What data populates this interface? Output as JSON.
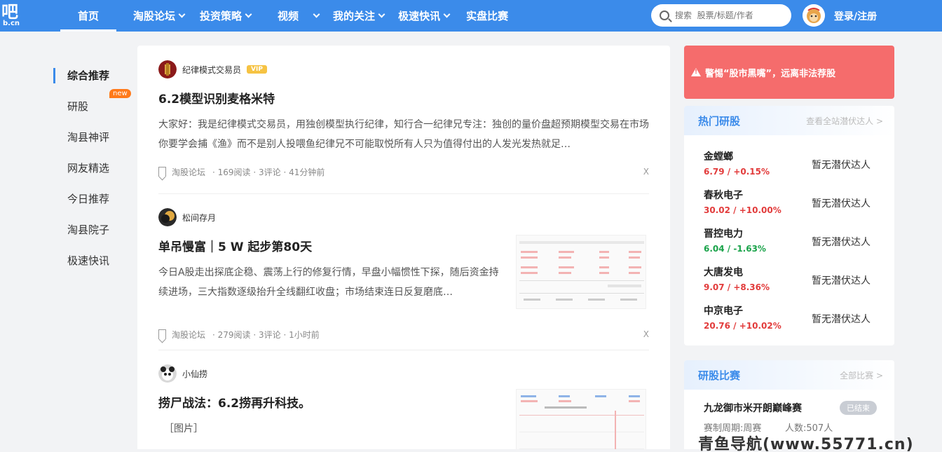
{
  "logo": {
    "main": "吧",
    "sub": "b.cn"
  },
  "nav": {
    "items": [
      {
        "label": "首页",
        "active": true,
        "dropdown": false
      },
      {
        "label": "淘股论坛",
        "active": false,
        "dropdown": true
      },
      {
        "label": "投资策略",
        "active": false,
        "dropdown": true
      },
      {
        "label": "视频",
        "active": false,
        "dropdown": true
      },
      {
        "label": "我的关注",
        "active": false,
        "dropdown": true
      },
      {
        "label": "极速快讯",
        "active": false,
        "dropdown": true
      },
      {
        "label": "实盘比赛",
        "active": false,
        "dropdown": false
      }
    ],
    "search_placeholder": "搜索  股票/标题/作者",
    "login": "登录/注册"
  },
  "left_menu": {
    "items": [
      {
        "label": "综合推荐",
        "active": true
      },
      {
        "label": "研股",
        "badge": "new"
      },
      {
        "label": "淘县神评"
      },
      {
        "label": "网友精选"
      },
      {
        "label": "今日推荐"
      },
      {
        "label": "淘县院子"
      },
      {
        "label": "极速快讯"
      }
    ]
  },
  "posts": [
    {
      "author": "纪律模式交易员",
      "vip": "VIP",
      "title": "6.2模型识别麦格米特",
      "text": "大家好：我是纪律模式交易员，用独创模型执行纪律，知行合一纪律兄专注：独创的量价盘超预期模型交易在市场你要学会捕《渔》而不是别人投喂鱼纪律兄不可能取悦所有人只为值得付出的人发光发热就足…",
      "forum": "淘股论坛",
      "stats": "· 169阅读 · 3评论 · 41分钟前",
      "close": "X"
    },
    {
      "author": "松间存月",
      "title": "单吊慢富｜5 W 起步第80天",
      "text": "今日A股走出探底企稳、震荡上行的修复行情，早盘小幅惯性下探，随后资金持续进场，三大指数逐级抬升全线翻红收盘；市场结束连日反复磨底…",
      "forum": "淘股论坛",
      "stats": "· 279阅读 · 3评论 · 1小时前",
      "close": "X"
    },
    {
      "author": "小仙捞",
      "title": "捞尸战法：6.2捞再升科技。",
      "text": "［图片］"
    }
  ],
  "warning": "警惕“股市黑嘴”，远离非法荐股",
  "hot_stocks": {
    "title": "热门研股",
    "more": "查看全站潜伏达人 >",
    "rows": [
      {
        "name": "金螳螂",
        "value": "6.79 / +0.15%",
        "trend": "up",
        "hint": "暂无潜伏达人"
      },
      {
        "name": "春秋电子",
        "value": "30.02 / +10.00%",
        "trend": "up",
        "hint": "暂无潜伏达人"
      },
      {
        "name": "晋控电力",
        "value": "6.04 / -1.63%",
        "trend": "down",
        "hint": "暂无潜伏达人"
      },
      {
        "name": "大唐发电",
        "value": "9.07 / +8.36%",
        "trend": "up",
        "hint": "暂无潜伏达人"
      },
      {
        "name": "中京电子",
        "value": "20.76 / +10.02%",
        "trend": "up",
        "hint": "暂无潜伏达人"
      }
    ]
  },
  "contest": {
    "title": "研股比赛",
    "more": "全部比赛 >",
    "item_title": "九龙御市米开朗巅峰赛",
    "status": "已结束",
    "period": "赛制周期:周赛",
    "people": "人数:507人"
  },
  "watermark": "青鱼导航(www.55771.cn)",
  "colors": {
    "brand": "#3b8bea",
    "up": "#e23b3b",
    "down": "#1aa34a",
    "warning": "#f56c6c"
  }
}
